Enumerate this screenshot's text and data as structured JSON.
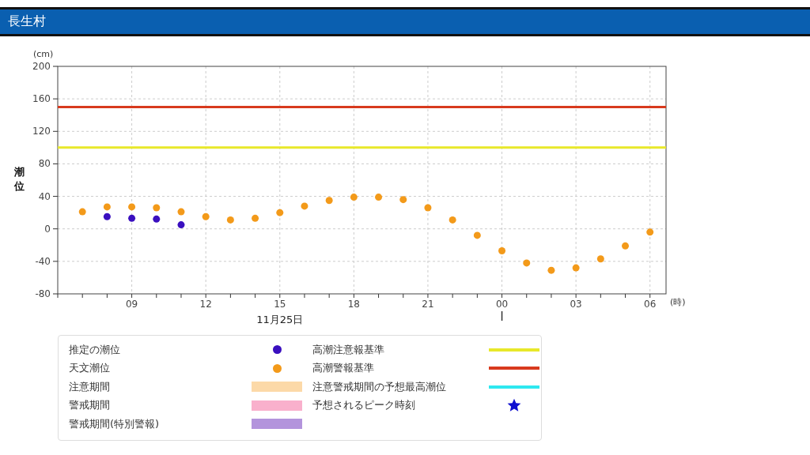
{
  "header": {
    "title": "長生村"
  },
  "chart": {
    "unit_y": "(cm)",
    "unit_x": "(時)",
    "date_label": "11月25日",
    "chart_data": {
      "type": "scatter",
      "ylabel": "潮位",
      "ylim": [
        -80,
        200
      ],
      "yticks": [
        -80,
        -40,
        0,
        40,
        80,
        120,
        160,
        200
      ],
      "categories": [
        null,
        null,
        "09",
        null,
        null,
        "12",
        null,
        null,
        "15",
        null,
        null,
        "18",
        null,
        null,
        "21",
        null,
        null,
        "00",
        null,
        null,
        "03",
        null,
        null,
        "06"
      ],
      "series": [
        {
          "name": "推定の潮位",
          "color": "#3a0fbf",
          "values": [
            null,
            15,
            13,
            12,
            5,
            null,
            null,
            null,
            null,
            null,
            null,
            null,
            null,
            null,
            null,
            null,
            null,
            null,
            null,
            null,
            null,
            null,
            null,
            null
          ]
        },
        {
          "name": "天文潮位",
          "color": "#f39a1a",
          "values": [
            21,
            27,
            27,
            26,
            21,
            15,
            11,
            13,
            20,
            28,
            35,
            39,
            39,
            36,
            26,
            11,
            -8,
            -27,
            -42,
            -51,
            -48,
            -37,
            -21,
            -4
          ]
        }
      ],
      "grid": true,
      "ref_lines": [
        {
          "axis": "y",
          "value": 150,
          "color": "#d83a1e"
        },
        {
          "axis": "y",
          "value": 100,
          "color": "#e8e82a"
        }
      ]
    }
  },
  "legend": {
    "bands": [
      {
        "label": "注意期間",
        "color": "#fcd9a8"
      },
      {
        "label": "警戒期間",
        "color": "#f9b0cc"
      },
      {
        "label": "警戒期間(特別警報)",
        "color": "#b394dc"
      }
    ],
    "items": [
      {
        "label": "高潮注意報基準",
        "kind": "line",
        "color": "#e8e82a"
      },
      {
        "label": "高潮警報基準",
        "kind": "line",
        "color": "#d83a1e"
      },
      {
        "label": "注意警戒期間の予想最高潮位",
        "kind": "line",
        "color": "#2ee8f0"
      },
      {
        "label": "予想されるピーク時刻",
        "kind": "star",
        "color": "#1010d0"
      }
    ]
  }
}
